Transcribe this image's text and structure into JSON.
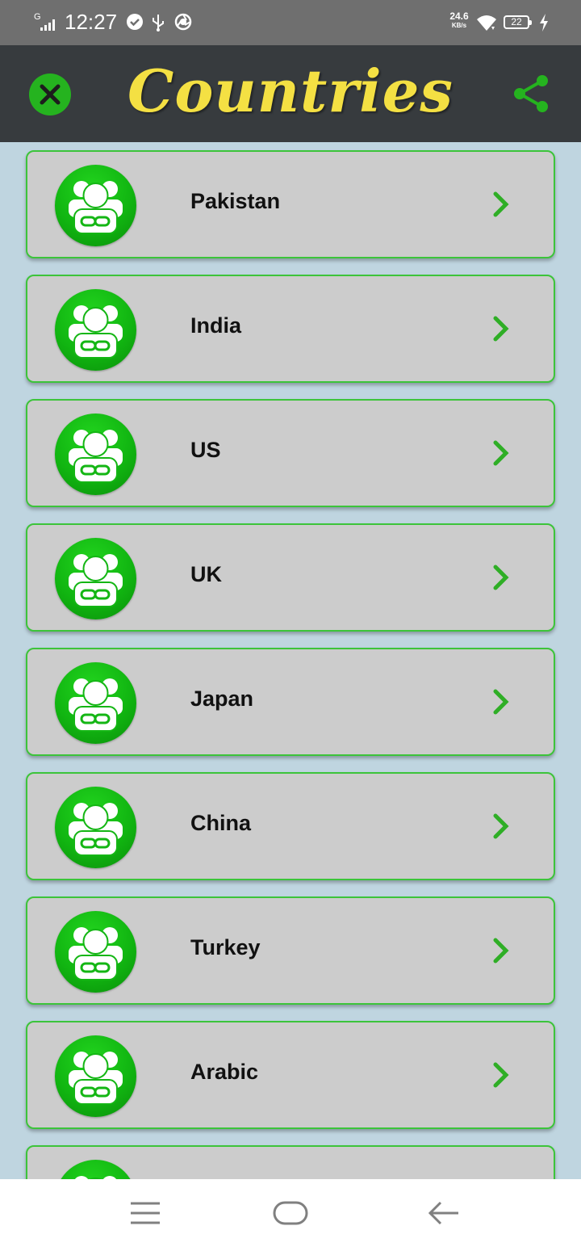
{
  "status_bar": {
    "network": "G",
    "time": "12:27",
    "speed_value": "24.6",
    "speed_unit": "KB/s",
    "battery": "22"
  },
  "app_bar": {
    "title": "Countries",
    "close_icon": "close-icon",
    "share_icon": "share-icon"
  },
  "countries": [
    {
      "label": "Pakistan"
    },
    {
      "label": "India"
    },
    {
      "label": "US"
    },
    {
      "label": "UK"
    },
    {
      "label": "Japan"
    },
    {
      "label": "China"
    },
    {
      "label": "Turkey"
    },
    {
      "label": "Arabic"
    },
    {
      "label": ""
    }
  ],
  "colors": {
    "accent": "#25b31f",
    "title": "#f4e043",
    "app_bar": "#373b3e",
    "card": "#cccccc",
    "background": "#bfd5e0"
  }
}
